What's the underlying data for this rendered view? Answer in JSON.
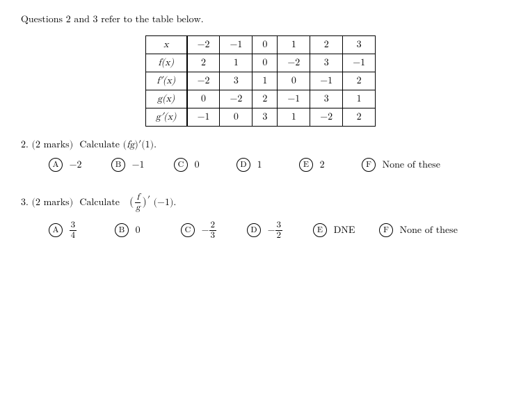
{
  "intro": "Questions 2 and 3 refer to the table below.",
  "table": {
    "headers": [
      "x",
      "-2",
      "-1",
      "0",
      "1",
      "2",
      "3"
    ],
    "rows": [
      {
        "label": "f(x)",
        "values": [
          "2",
          "1",
          "0",
          "-2",
          "3",
          "-1"
        ]
      },
      {
        "label": "f′(x)",
        "values": [
          "-2",
          "3",
          "1",
          "0",
          "-1",
          "2"
        ]
      },
      {
        "label": "g(x)",
        "values": [
          "0",
          "-2",
          "2",
          "-1",
          "3",
          "1"
        ]
      },
      {
        "label": "g′(x)",
        "values": [
          "-1",
          "0",
          "3",
          "1",
          "-2",
          "2"
        ]
      }
    ]
  },
  "question2": {
    "label": "2. (2 marks)  Calculate ",
    "expr": "(fg)′(1).",
    "choices": [
      {
        "letter": "A",
        "value": "−2"
      },
      {
        "letter": "B",
        "value": "−1"
      },
      {
        "letter": "C",
        "value": "0"
      },
      {
        "letter": "D",
        "value": "1"
      },
      {
        "letter": "E",
        "value": "2"
      },
      {
        "letter": "F",
        "value": "None of these"
      }
    ]
  },
  "question3": {
    "label": "3. (2 marks)  Calculate ",
    "expr": "(f/g)′(−1).",
    "choices": [
      {
        "letter": "A",
        "value_display": "3/4"
      },
      {
        "letter": "B",
        "value": "0"
      },
      {
        "letter": "C",
        "value_display": "-2/3"
      },
      {
        "letter": "D",
        "value_display": "-3/2"
      },
      {
        "letter": "E",
        "value": "DNE"
      },
      {
        "letter": "F",
        "value": "None of these"
      }
    ]
  }
}
